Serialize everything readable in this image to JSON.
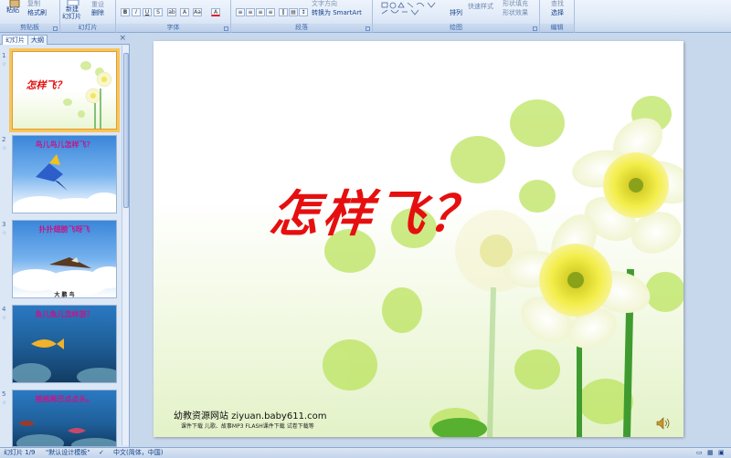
{
  "ribbon": {
    "clipboard": {
      "label": "剪贴板",
      "paste": "粘贴",
      "copy": "复制",
      "format_painter": "格式刷"
    },
    "slides": {
      "label": "幻灯片",
      "new_slide": "新建",
      "new_slide_2": "幻灯片",
      "reset": "重设",
      "delete": "删除"
    },
    "font": {
      "label": "字体"
    },
    "paragraph": {
      "label": "段落",
      "text_direction": "文字方向",
      "smartart": "转换为 SmartArt"
    },
    "drawing": {
      "label": "绘图",
      "arrange": "排列",
      "quick_styles": "快速样式",
      "shape_fill": "形状填充",
      "shape_effects": "形状效果"
    },
    "editing": {
      "label": "编辑",
      "find": "查找",
      "select": "选择"
    }
  },
  "left_pane": {
    "tabs": [
      "幻灯片",
      "大纲"
    ],
    "close": "×",
    "slides": [
      {
        "num": "1",
        "title": "怎样飞？",
        "bg": "flower"
      },
      {
        "num": "2",
        "title": "鸟儿鸟儿怎样飞？",
        "bg": "sky"
      },
      {
        "num": "3",
        "title": "扑扑翅膀飞呀飞",
        "caption": "大 鹏 鸟",
        "bg": "sky"
      },
      {
        "num": "4",
        "title": "鱼儿鱼儿怎样游？",
        "bg": "sea"
      },
      {
        "num": "5",
        "title": "摇摇尾巴点点头。",
        "bg": "sea"
      }
    ]
  },
  "slide": {
    "title": "怎样飞？",
    "footer_main": "幼教资源网站  ziyuan.baby611.com",
    "footer_sub": "课件下载    儿歌、故事MP3    FLASH课件下载   试卷下载等"
  },
  "status": {
    "slide_pos": "幻灯片 1/9",
    "theme": "\"默认设计模板\"",
    "language": "中文(简体，中国)"
  },
  "colors": {
    "title_red": "#e60f0f",
    "thumb_title": "#c0188a",
    "ribbon_text": "#15428b"
  }
}
